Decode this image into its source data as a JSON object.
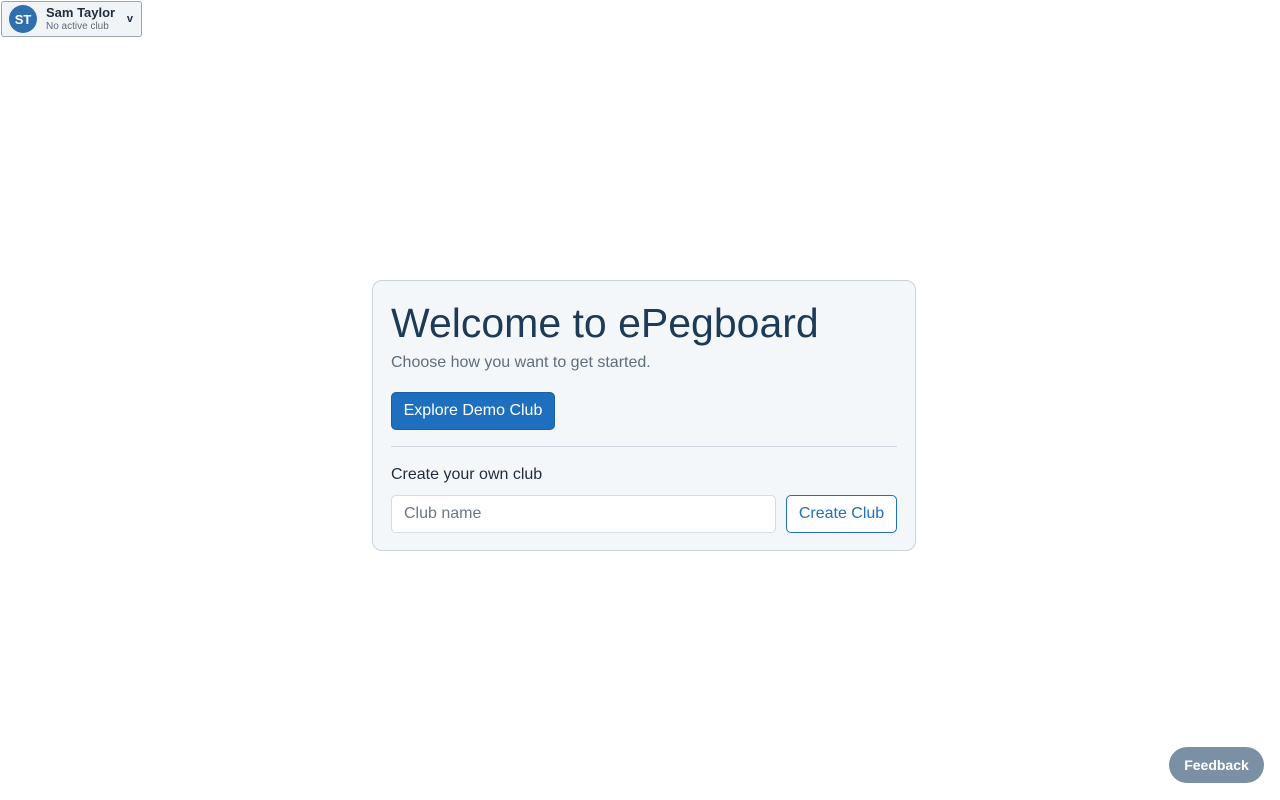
{
  "user_menu": {
    "initials": "ST",
    "name": "Sam Taylor",
    "status": "No active club",
    "chevron": "v"
  },
  "welcome": {
    "title": "Welcome to ePegboard",
    "subtitle": "Choose how you want to get started.",
    "demo_button": "Explore Demo Club",
    "create_section_label": "Create your own club",
    "club_name_placeholder": "Club name",
    "club_name_value": "",
    "create_button": "Create Club"
  },
  "feedback": {
    "label": "Feedback"
  },
  "colors": {
    "primary": "#1f6fbf",
    "avatar": "#2f6fad",
    "feedback": "#7c90a5",
    "title": "#1d3a56"
  }
}
